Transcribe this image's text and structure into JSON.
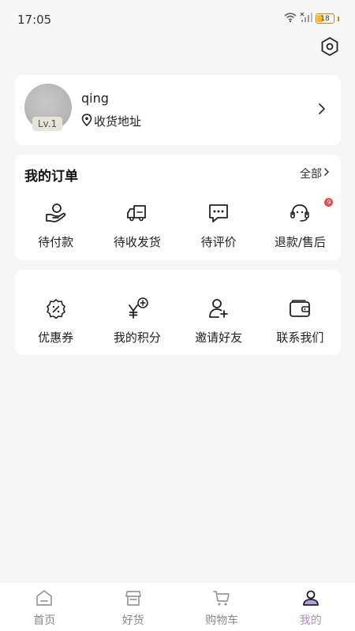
{
  "status_bar": {
    "time": "17:05",
    "battery": "18"
  },
  "profile": {
    "username": "qing",
    "level": "Lv.1",
    "address_label": "收货地址"
  },
  "orders": {
    "title": "我的订单",
    "all_label": "全部",
    "items": [
      {
        "label": "待付款",
        "icon": "wallet-hand-icon"
      },
      {
        "label": "待收发货",
        "icon": "truck-icon"
      },
      {
        "label": "待评价",
        "icon": "chat-bubble-icon"
      },
      {
        "label": "退款/售后",
        "icon": "headset-icon",
        "badge": "9"
      }
    ]
  },
  "tools": {
    "items": [
      {
        "label": "优惠券",
        "icon": "coupon-icon"
      },
      {
        "label": "我的积分",
        "icon": "points-icon"
      },
      {
        "label": "邀请好友",
        "icon": "add-friend-icon"
      },
      {
        "label": "联系我们",
        "icon": "contact-wallet-icon"
      }
    ]
  },
  "tabbar": {
    "active_color": "#a98ed0",
    "items": [
      {
        "label": "首页",
        "icon": "home-icon"
      },
      {
        "label": "好货",
        "icon": "store-icon"
      },
      {
        "label": "购物车",
        "icon": "cart-icon"
      },
      {
        "label": "我的",
        "icon": "user-icon",
        "active": true
      }
    ]
  }
}
